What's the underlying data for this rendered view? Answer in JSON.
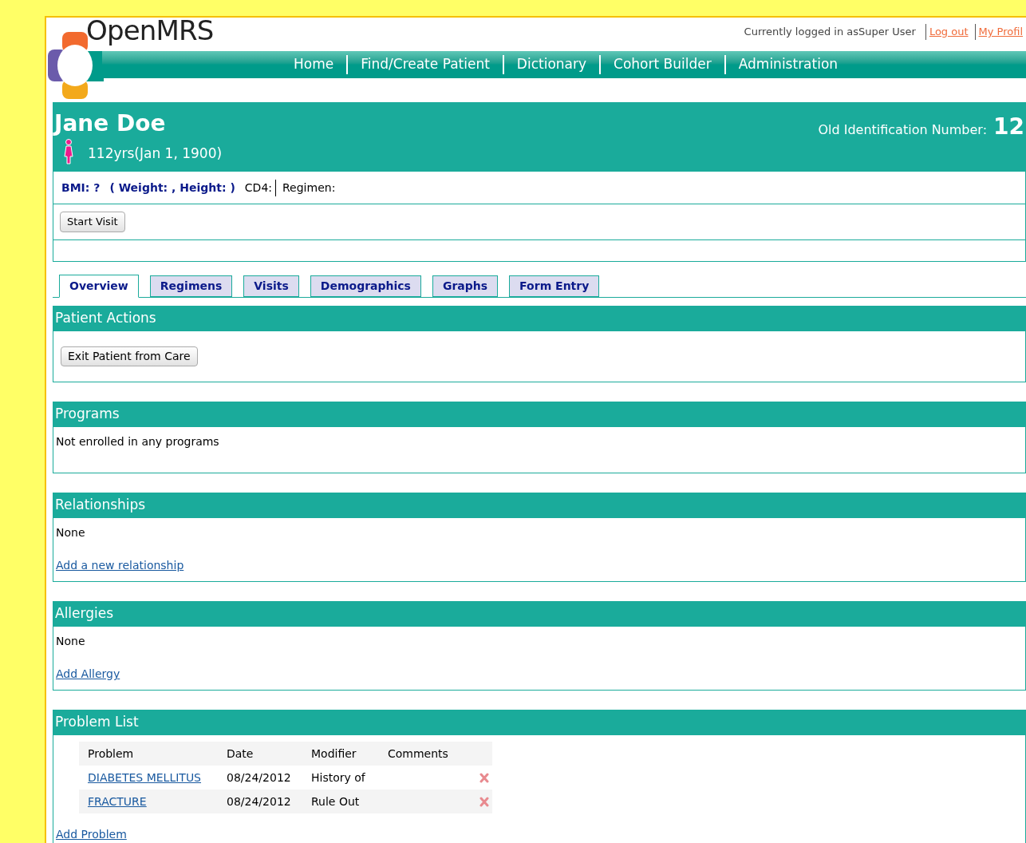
{
  "header": {
    "logo_text": "OpenMRS",
    "login_text": "Currently logged in asSuper User",
    "links": [
      "Log out",
      "My Profil"
    ]
  },
  "nav": [
    "Home",
    "Find/Create Patient",
    "Dictionary",
    "Cohort Builder",
    "Administration"
  ],
  "patient": {
    "name": "Jane Doe",
    "age": "112yrs(Jan 1, 1900)",
    "id_label": "Old Identification Number:",
    "id_value": "12"
  },
  "summary": {
    "bmi": "BMI: ?",
    "weight_height": "( Weight: , Height: )",
    "cd4": "CD4:",
    "regimen": "Regimen:"
  },
  "visit_button": "Start Visit",
  "tabs": [
    {
      "label": "Overview",
      "selected": true
    },
    {
      "label": "Regimens",
      "selected": false
    },
    {
      "label": "Visits",
      "selected": false
    },
    {
      "label": "Demographics",
      "selected": false
    },
    {
      "label": "Graphs",
      "selected": false
    },
    {
      "label": "Form Entry",
      "selected": false
    }
  ],
  "sections": [
    {
      "kind": "button",
      "title": "Patient Actions",
      "button": "Exit Patient from Care"
    },
    {
      "kind": "text",
      "title": "Programs",
      "text": "Not enrolled in any programs"
    },
    {
      "kind": "textlink",
      "title": "Relationships",
      "text": "None",
      "link": "Add a new relationship"
    },
    {
      "kind": "textlink",
      "title": "Allergies",
      "text": "None",
      "link": "Add Allergy"
    },
    {
      "kind": "table",
      "title": "Problem List",
      "columns": [
        "Problem",
        "Date",
        "Modifier",
        "Comments"
      ],
      "rows": [
        {
          "problem": "DIABETES MELLITUS",
          "date": "08/24/2012",
          "modifier": "History of"
        },
        {
          "problem": "FRACTURE",
          "date": "08/24/2012",
          "modifier": "Rule Out"
        }
      ],
      "link": "Add Problem"
    }
  ]
}
